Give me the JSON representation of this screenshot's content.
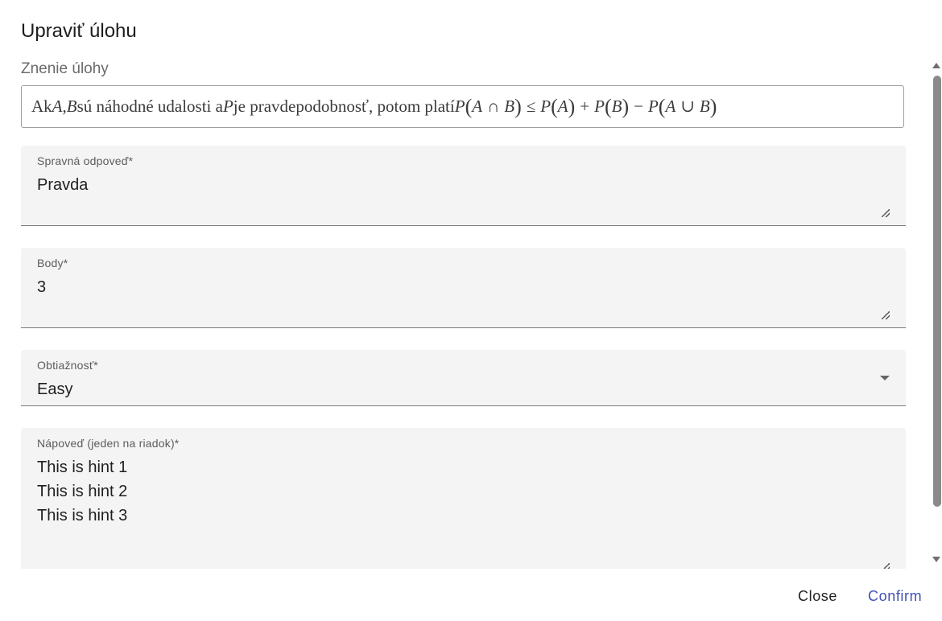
{
  "dialog": {
    "title": "Upraviť úlohu"
  },
  "statement": {
    "label": "Znenie úlohy",
    "parts": {
      "t1": "Ak ",
      "A": "A",
      "comma": ",",
      "B": "B",
      "t2": " sú náhodné udalosti a ",
      "P": "P",
      "t3": " je pravdepodobnosť, potom platí ",
      "cap": "∩",
      "le": "≤",
      "plus": "+",
      "minus": "−",
      "cup": "∪",
      "lp": "(",
      "rp": ")"
    }
  },
  "fields": {
    "correct_answer": {
      "label": "Spravná odpoveď*",
      "value": "Pravda"
    },
    "points": {
      "label": "Body*",
      "value": "3"
    },
    "difficulty": {
      "label": "Obtiažnosť*",
      "value": "Easy"
    },
    "hints": {
      "label": "Nápoveď (jeden na riadok)*",
      "lines": [
        "This is hint 1",
        "This is hint 2",
        "This is hint 3"
      ]
    }
  },
  "actions": {
    "close": "Close",
    "confirm": "Confirm"
  },
  "colors": {
    "primary": "#3f51b5",
    "field_bg": "#f4f4f4"
  }
}
